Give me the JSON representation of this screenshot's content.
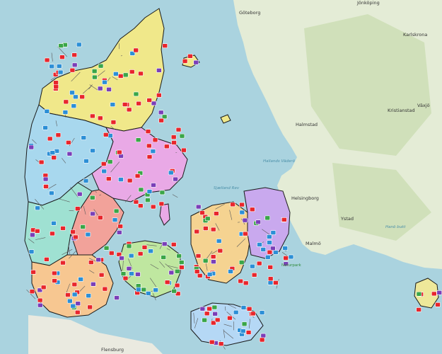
{
  "map": {
    "colors": {
      "sea": "#aad3df",
      "sweden_land": "#e4ecd6",
      "sweden_forest": "#c8dcae",
      "germany_land": "#eaeae0",
      "border": "#1a1a1a",
      "municipal_border": "#5a5a5a",
      "marker_red": "#e8262c",
      "marker_blue": "#2c8fd6",
      "marker_green": "#3aa648",
      "marker_purple": "#7a3fb8"
    },
    "labels": {
      "goteborg": "Göteborg",
      "jonkoping": "Jönköping",
      "halmstad": "Halmstad",
      "helsingborg": "Helsingborg",
      "malmo": "Malmö",
      "kristianstad": "Kristianstad",
      "vaxjo": "Växjö",
      "karlskrona": "Karlskrona",
      "ystad": "Ystad",
      "sjaelland_rev": "Sjælland Rev",
      "hallands_vaderos": "Hallands Väderö",
      "bornholm_hanoe": "Hanö bukt",
      "flensburg": "Flensburg",
      "natura": "Naturpark"
    },
    "regions": [
      {
        "name": "north-jutland",
        "color": "#f0e88a"
      },
      {
        "name": "central-jutland-west",
        "color": "#a8d8ee"
      },
      {
        "name": "central-jutland-east",
        "color": "#e9a9e6"
      },
      {
        "name": "south-jutland-west",
        "color": "#9fe1d2"
      },
      {
        "name": "south-jutland-mid",
        "color": "#f2a29a"
      },
      {
        "name": "south-jutland-south",
        "color": "#f7c791"
      },
      {
        "name": "funen",
        "color": "#bfe7a0"
      },
      {
        "name": "zealand-west",
        "color": "#f5d391"
      },
      {
        "name": "copenhagen",
        "color": "#c9a9ee"
      },
      {
        "name": "lolland-falster",
        "color": "#b5d8f5"
      },
      {
        "name": "bornholm",
        "color": "#eee89a"
      }
    ]
  }
}
